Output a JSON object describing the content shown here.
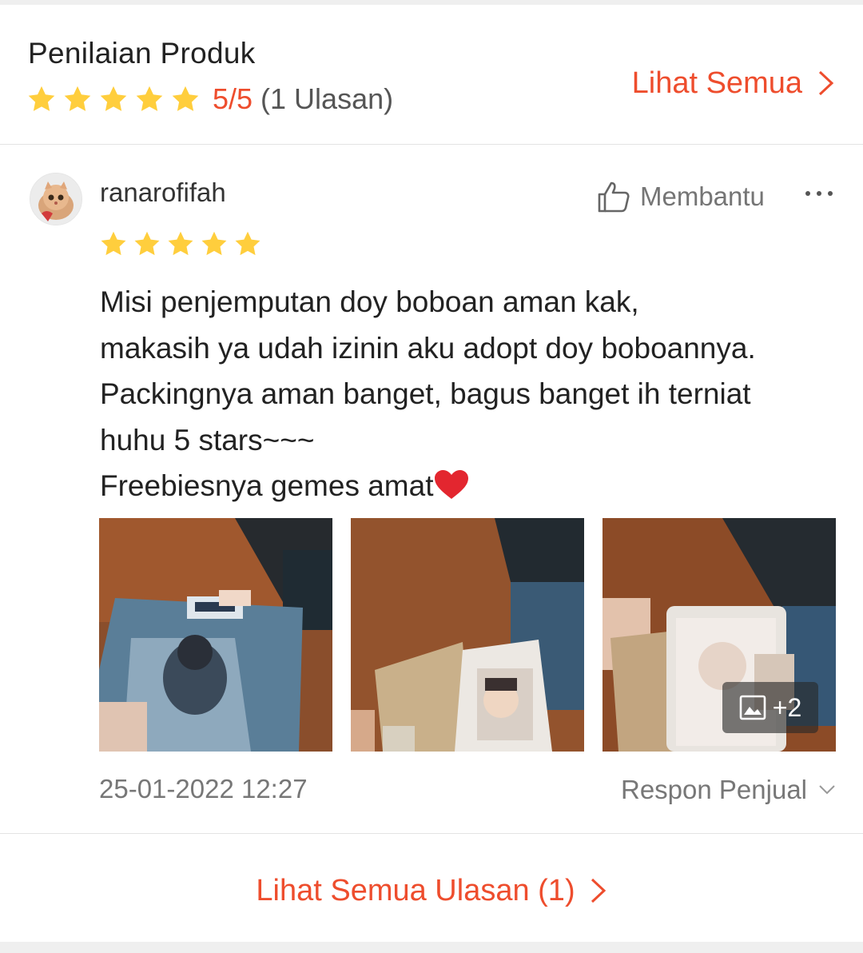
{
  "colors": {
    "accent": "#ee4d2d",
    "star": "#ffce3d"
  },
  "header": {
    "title": "Penilaian Produk",
    "rating_score": "5/5",
    "rating_count": "(1 Ulasan)",
    "rating_stars": 5,
    "see_all_label": "Lihat Semua"
  },
  "review": {
    "username": "ranarofifah",
    "avatar_icon": "cat-avatar",
    "helpful_label": "Membantu",
    "stars": 5,
    "text": "Misi penjemputan doy boboan aman kak,\nmakasih ya udah izinin aku adopt doy boboannya.\nPackingnya aman banget, bagus banget ih terniat\nhuhu 5 stars~~~\nFreebiesnya gemes amat",
    "text_emoji": "red-heart-icon",
    "more_photos_label": "+2",
    "date": "25-01-2022 12:27",
    "seller_reply_label": "Respon Penjual"
  },
  "footer": {
    "all_reviews_label": "Lihat Semua Ulasan (1)"
  }
}
